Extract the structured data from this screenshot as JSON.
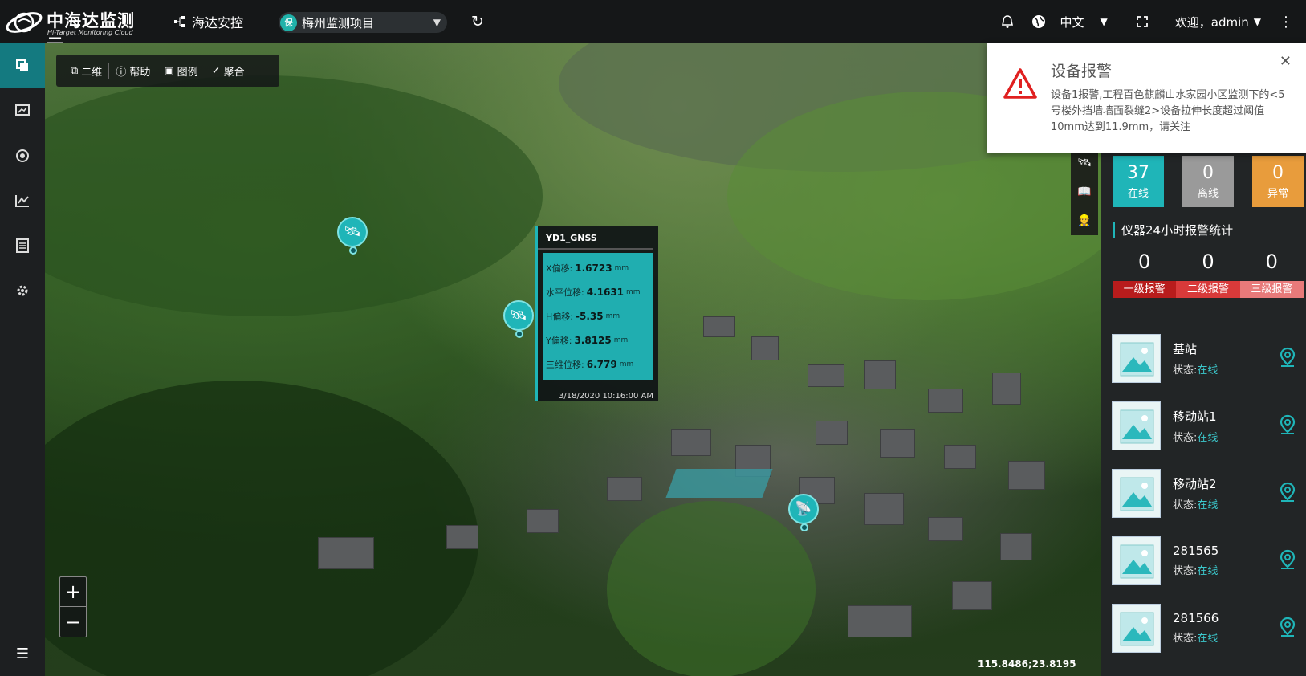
{
  "header": {
    "brand": "中海达监测云",
    "brand_sub": "Hi-Target Monitoring Cloud",
    "nav_main": "海达安控",
    "project_badge": "保",
    "project_name": "梅州监测项目",
    "lang": "中文",
    "welcome": "欢迎，admin"
  },
  "sidebar": {
    "items": [
      "layers-icon",
      "dashboard-icon",
      "sensor-icon",
      "chart-icon",
      "report-icon",
      "settings-icon"
    ]
  },
  "map_toolbar": {
    "items": [
      {
        "label": "二维",
        "icon": "2d-icon"
      },
      {
        "label": "帮助",
        "icon": "help-icon"
      },
      {
        "label": "图例",
        "icon": "image-icon"
      },
      {
        "label": "聚合",
        "icon": "check-circle-icon"
      }
    ]
  },
  "popup": {
    "title": "YD1_GNSS",
    "rows": [
      {
        "label": "X偏移:",
        "value": "1.6723",
        "unit": "mm"
      },
      {
        "label": "水平位移:",
        "value": "4.1631",
        "unit": "mm"
      },
      {
        "label": "H偏移:",
        "value": "-5.35",
        "unit": "mm"
      },
      {
        "label": "Y偏移:",
        "value": "3.8125",
        "unit": "mm"
      },
      {
        "label": "三维位移:",
        "value": "6.779",
        "unit": "mm"
      }
    ],
    "time": "3/18/2020 10:16:00 AM"
  },
  "map": {
    "coords": "115.8486;23.8195"
  },
  "status": {
    "online": {
      "count": "37",
      "label": "在线",
      "color": "#1fb5b8"
    },
    "offline": {
      "count": "0",
      "label": "离线",
      "color": "#9a9a9a"
    },
    "abnormal": {
      "count": "0",
      "label": "异常",
      "color": "#e89c3c"
    }
  },
  "alarm_stats": {
    "title": "仪器24小时报警统计",
    "levels": [
      {
        "count": "0",
        "label": "一级报警",
        "color": "#b81c1c"
      },
      {
        "count": "0",
        "label": "二级报警",
        "color": "#d83a3a"
      },
      {
        "count": "0",
        "label": "三级报警",
        "color": "#e87a7a"
      }
    ]
  },
  "devices": {
    "status_label": "状态:",
    "items": [
      {
        "name": "基站",
        "status": "在线"
      },
      {
        "name": "移动站1",
        "status": "在线"
      },
      {
        "name": "移动站2",
        "status": "在线"
      },
      {
        "name": "281565",
        "status": "在线"
      },
      {
        "name": "281566",
        "status": "在线"
      }
    ]
  },
  "toast": {
    "title": "设备报警",
    "message": "设备1报警,工程百色麒麟山水家园小区监测下的<5号楼外挡墙墙面裂缝2>设备拉伸长度超过阈值10mm达到11.9mm，请关注"
  }
}
